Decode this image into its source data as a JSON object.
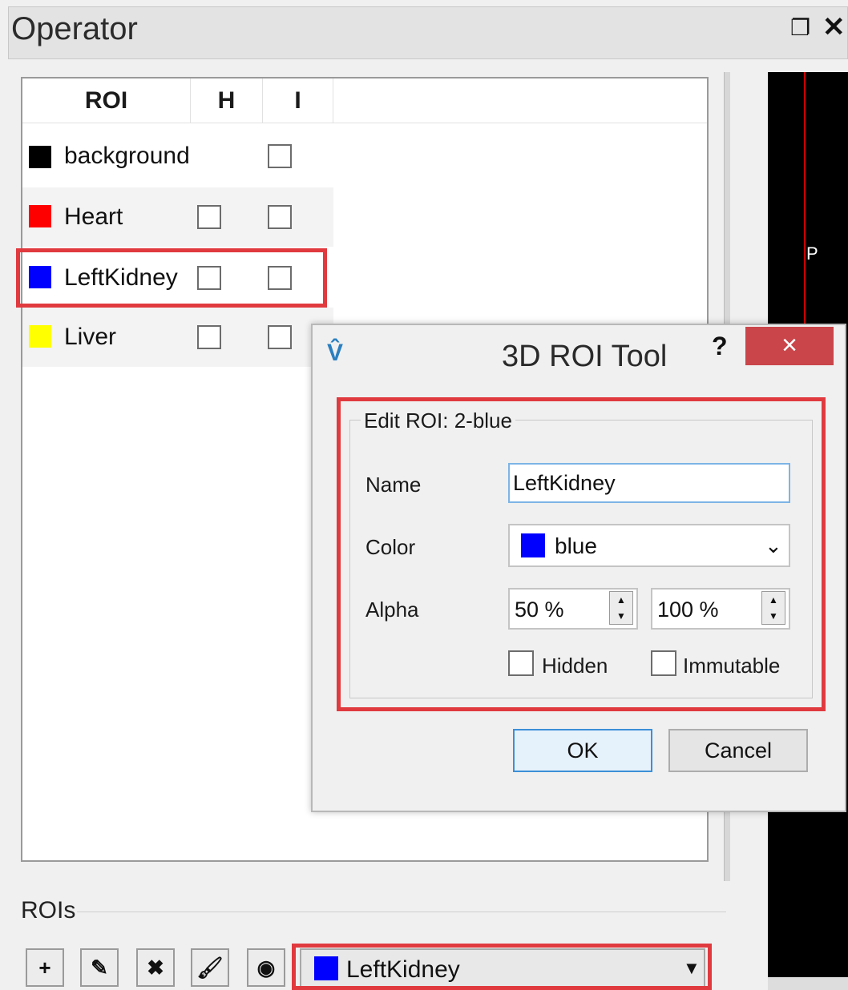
{
  "panel": {
    "title": "Operator"
  },
  "viewer": {
    "label": "P"
  },
  "roi_table": {
    "headers": [
      "ROI",
      "H",
      "I"
    ],
    "rows": [
      {
        "name": "background",
        "color": "#000000",
        "h_checkbox": false,
        "i_checked": false
      },
      {
        "name": "Heart",
        "color": "#ff0000",
        "h_checkbox": true,
        "h_checked": false,
        "i_checked": false
      },
      {
        "name": "LeftKidney",
        "color": "#0000ff",
        "h_checkbox": true,
        "h_checked": false,
        "i_checked": false
      },
      {
        "name": "Liver",
        "color": "#ffff00",
        "h_checkbox": true,
        "h_checked": false,
        "i_checked": false
      }
    ]
  },
  "dialog": {
    "title": "3D ROI Tool",
    "help": "?",
    "close": "×",
    "group_label": "Edit ROI: 2-blue",
    "name_label": "Name",
    "name_value": "LeftKidney",
    "color_label": "Color",
    "color_value": "blue",
    "color_hex": "#0000ff",
    "alpha_label": "Alpha",
    "alpha_1": "50 %",
    "alpha_2": "100 %",
    "hidden_label": "Hidden",
    "immutable_label": "Immutable",
    "ok_label": "OK",
    "cancel_label": "Cancel"
  },
  "rois_section": {
    "label": "ROIs",
    "tools": [
      "add-icon",
      "pencil-icon",
      "delete-icon",
      "brush-icon",
      "eye-icon"
    ],
    "selected": "LeftKidney",
    "selected_color": "#0000ff"
  },
  "highlight_color": "#e03a3f"
}
